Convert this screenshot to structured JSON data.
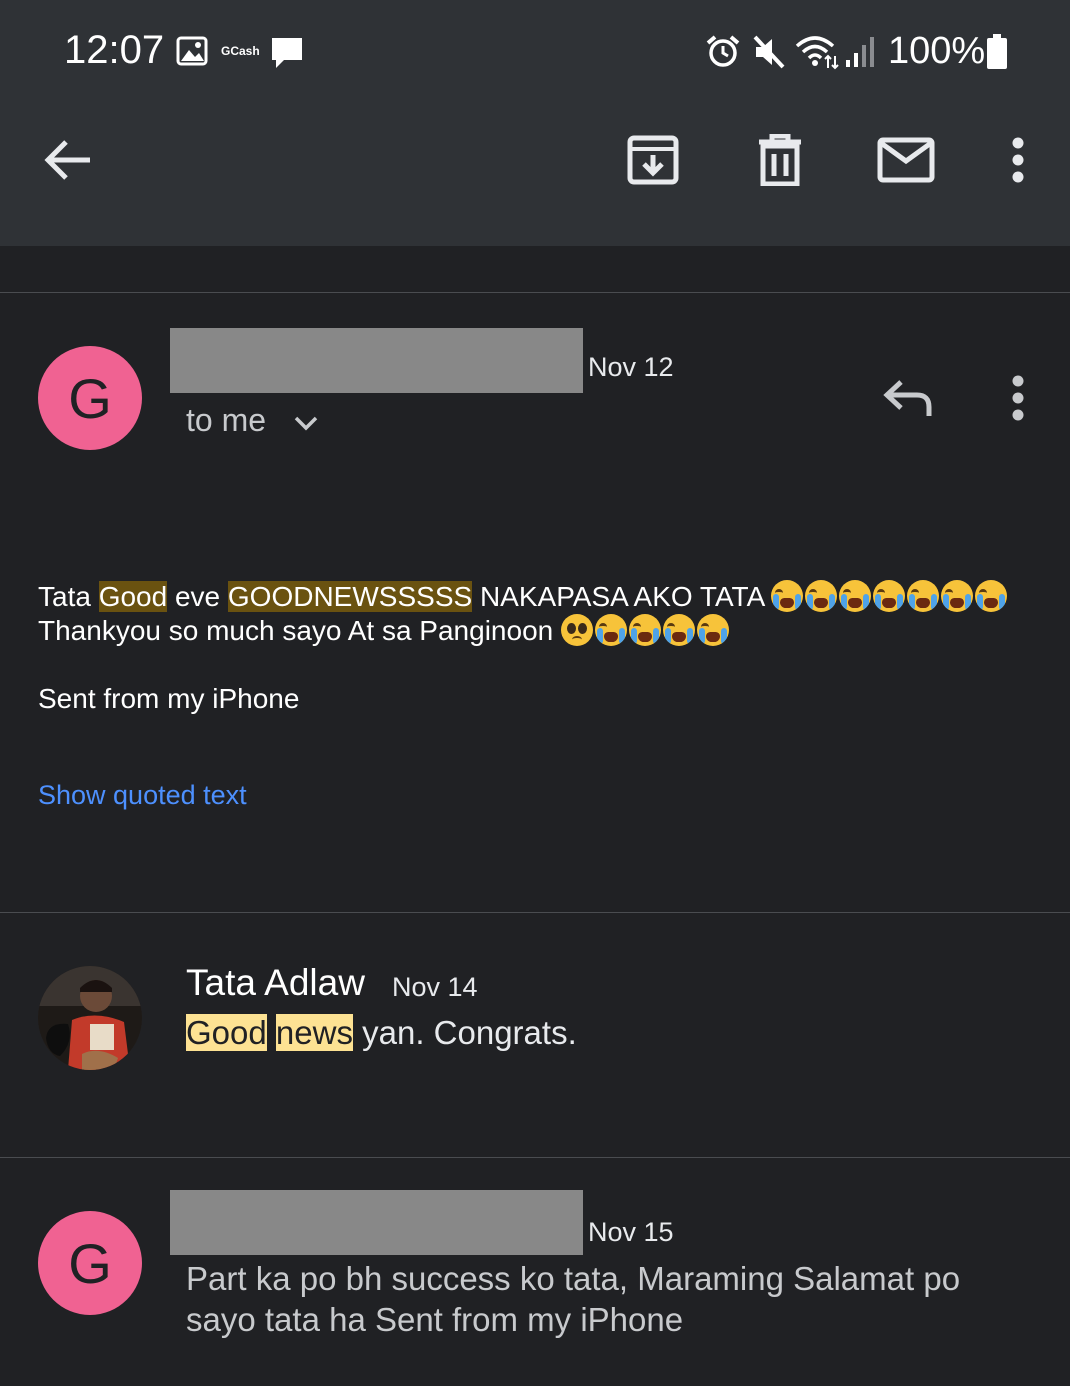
{
  "status_bar": {
    "time": "12:07",
    "notif_gcash": "GCash",
    "battery": "100%",
    "icons": [
      "image-icon",
      "gcash-icon",
      "chat-icon",
      "alarm-icon",
      "mute-icon",
      "wifi-icon",
      "signal-icon",
      "battery-icon"
    ]
  },
  "toolbar": {
    "icons": [
      "back-arrow-icon",
      "archive-icon",
      "delete-icon",
      "mark-unread-icon",
      "more-vert-icon"
    ]
  },
  "messages": [
    {
      "avatar_letter": "G",
      "date": "Nov 12",
      "recipient": "to me",
      "body_line1": {
        "t1": "Tata ",
        "h1": "Good",
        "t2": " eve ",
        "h2": "GOODNEWSSSSS",
        "t3": " NAKAPASA AKO TATA "
      },
      "body_line2": "Thankyou so much sayo At sa Panginoon ",
      "signature": "Sent from my iPhone",
      "show_quoted": "Show quoted text"
    },
    {
      "sender": "Tata Adlaw",
      "date": "Nov 14",
      "h1": "Good",
      "h2": "news",
      "rest": " yan. Congrats."
    },
    {
      "avatar_letter": "G",
      "date": "Nov 15",
      "snippet": "Part ka po bh success ko tata, Maraming Salamat po sayo tata ha Sent from my iPhone"
    }
  ],
  "colors": {
    "background": "#202124",
    "header": "#2f3236",
    "avatar_g": "#f06292",
    "link": "#4d90fe",
    "highlight_dark": "#6a5210",
    "highlight_light": "#fde293"
  }
}
